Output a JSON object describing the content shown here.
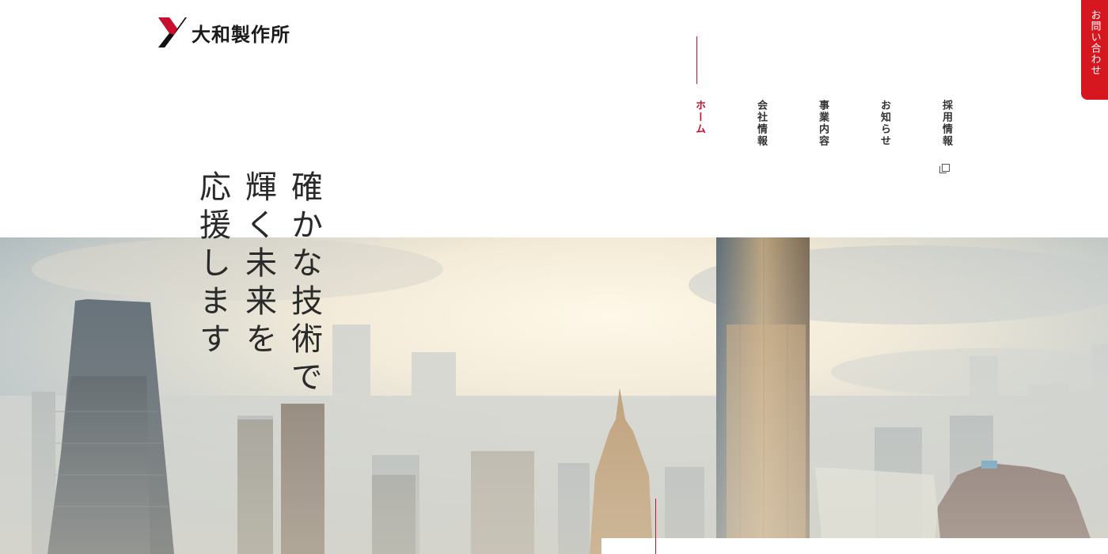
{
  "brand": {
    "name": "大和製作所",
    "accent": "#c8102e"
  },
  "nav": {
    "items": [
      {
        "label": "ホーム",
        "active": true
      },
      {
        "label": "会社情報",
        "active": false
      },
      {
        "label": "事業内容",
        "active": false
      },
      {
        "label": "お知らせ",
        "active": false
      },
      {
        "label": "採用情報",
        "active": false,
        "icon": "external-link-icon"
      }
    ]
  },
  "contact": {
    "label": "お問い合わせ",
    "color": "#d7171f"
  },
  "hero": {
    "catch_lines": [
      "確かな技術で",
      "輝く未来を",
      "応援します"
    ]
  }
}
